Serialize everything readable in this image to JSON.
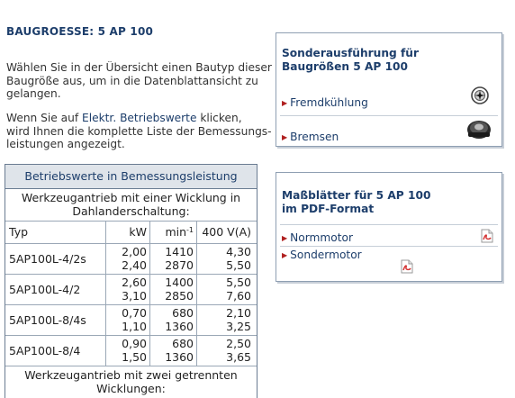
{
  "title": "BAUGROESSE: 5 AP 100",
  "intro": {
    "p1_lines": [
      "Wählen Sie in der Übersicht einen Bautyp dieser",
      "Baugröße aus, um in die Datenblattansicht zu",
      "gelangen."
    ],
    "p2_line1_a": "Wenn Sie auf ",
    "p2_link": "Elektr. Betriebswerte",
    "p2_line1_b": " klicken,",
    "p2_line2": "wird Ihnen die komplette Liste der Bemessungs-",
    "p2_line3": "leistungen angezeigt."
  },
  "table": {
    "header": "Betriebswerte in Bemessungsleistung",
    "group1_line1": "Werkzeugantrieb mit einer Wicklung in",
    "group1_line2": "Dahlanderschaltung:",
    "columns": {
      "typ": "Typ",
      "kw": "kW",
      "min": "min",
      "min_sup": "-1",
      "v": "400 V(A)"
    },
    "rows": [
      {
        "typ": "5AP100L-4/2s",
        "kw1": "2,00",
        "kw2": "2,40",
        "min1": "1410",
        "min2": "2870",
        "v1": "4,30",
        "v2": "5,50"
      },
      {
        "typ": "5AP100L-4/2",
        "kw1": "2,60",
        "kw2": "3,10",
        "min1": "1400",
        "min2": "2850",
        "v1": "5,50",
        "v2": "7,60"
      },
      {
        "typ": "5AP100L-8/4s",
        "kw1": "0,70",
        "kw2": "1,10",
        "min1": "680",
        "min2": "1360",
        "v1": "2,10",
        "v2": "3,25"
      },
      {
        "typ": "5AP100L-8/4",
        "kw1": "0,90",
        "kw2": "1,50",
        "min1": "680",
        "min2": "1360",
        "v1": "2,50",
        "v2": "3,65"
      }
    ],
    "group2_line1": "Werkzeugantrieb mit zwei getrennten",
    "group2_line2": "Wicklungen:"
  },
  "box_special": {
    "title_line1": "Sonderausführung für",
    "title_line2": "Baugrößen 5 AP 100",
    "items": [
      {
        "label": "Fremdkühlung",
        "icon": "fan-icon"
      },
      {
        "label": "Bremsen",
        "icon": "brake-icon"
      }
    ]
  },
  "box_pdf": {
    "title_line1": "Maßblätter für 5 AP 100",
    "title_line2": "im PDF-Format",
    "items": [
      {
        "label": "Normmotor",
        "icon": "pdf-icon"
      },
      {
        "label": "Sondermotor",
        "icon": "pdf-icon"
      }
    ]
  },
  "colors": {
    "heading": "#1d3e6b",
    "text": "#333333",
    "arrow": "#b02020",
    "table_header_bg": "#dfe4ea",
    "pdf": "#d32f2f"
  }
}
